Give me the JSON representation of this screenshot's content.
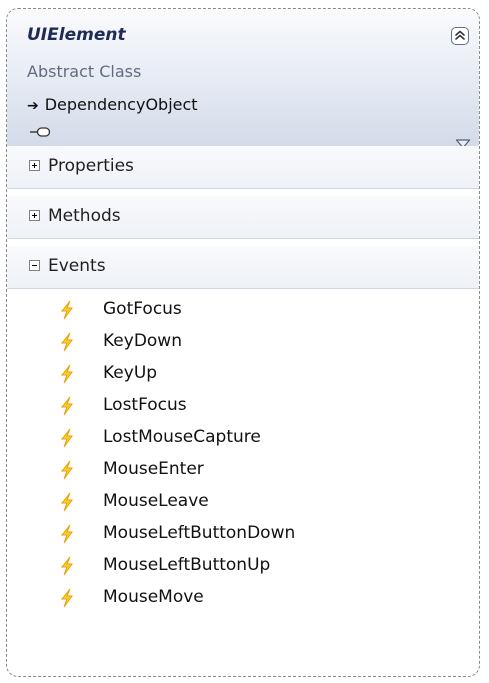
{
  "class_box": {
    "name": "UIElement",
    "kind": "Abstract Class",
    "base_arrow": "➔",
    "base_class": "DependencyObject"
  },
  "sections": [
    {
      "label": "Properties",
      "state": "collapsed"
    },
    {
      "label": "Methods",
      "state": "collapsed"
    },
    {
      "label": "Events",
      "state": "expanded"
    }
  ],
  "events": [
    {
      "label": "GotFocus"
    },
    {
      "label": "KeyDown"
    },
    {
      "label": "KeyUp"
    },
    {
      "label": "LostFocus"
    },
    {
      "label": "LostMouseCapture"
    },
    {
      "label": "MouseEnter"
    },
    {
      "label": "MouseLeave"
    },
    {
      "label": "MouseLeftButtonDown"
    },
    {
      "label": "MouseLeftButtonUp"
    },
    {
      "label": "MouseMove"
    }
  ],
  "colors": {
    "header_top": "#fafbfd",
    "header_bottom": "#d3dbe9",
    "event_icon": "#e6a100",
    "class_name": "#1f2b55"
  },
  "icons": {
    "collapse": "collapse-up-icon",
    "interface": "interface-lollipop-icon",
    "filter": "filter-icon",
    "event": "lightning-bolt-icon"
  }
}
